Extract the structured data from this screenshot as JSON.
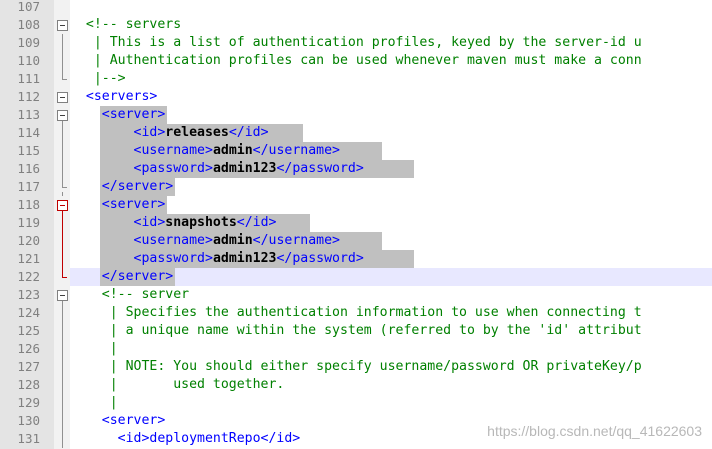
{
  "editor": {
    "lines": [
      {
        "no": "107",
        "segs": []
      },
      {
        "no": "108",
        "segs": [
          {
            "t": "  <!-- servers",
            "c": "cmt"
          }
        ]
      },
      {
        "no": "109",
        "segs": [
          {
            "t": "   | This is a list of authentication profiles, keyed by the server-id u",
            "c": "cmt"
          }
        ]
      },
      {
        "no": "110",
        "segs": [
          {
            "t": "   | Authentication profiles can be used whenever maven must make a conn",
            "c": "cmt"
          }
        ]
      },
      {
        "no": "111",
        "segs": [
          {
            "t": "   |-->",
            "c": "cmt"
          }
        ]
      },
      {
        "no": "112",
        "segs": [
          {
            "t": "  <servers>",
            "c": "tag"
          }
        ]
      },
      {
        "no": "113",
        "segs": [
          {
            "t": "    ",
            "c": "pl"
          },
          {
            "t": "<server>",
            "c": "tag"
          }
        ]
      },
      {
        "no": "114",
        "segs": [
          {
            "t": "        ",
            "c": "pl"
          },
          {
            "t": "<id>",
            "c": "tag"
          },
          {
            "t": "releases",
            "c": "txt"
          },
          {
            "t": "</id>",
            "c": "tag"
          }
        ]
      },
      {
        "no": "115",
        "segs": [
          {
            "t": "        ",
            "c": "pl"
          },
          {
            "t": "<username>",
            "c": "tag"
          },
          {
            "t": "admin",
            "c": "txt"
          },
          {
            "t": "</username>",
            "c": "tag"
          }
        ]
      },
      {
        "no": "116",
        "segs": [
          {
            "t": "        ",
            "c": "pl"
          },
          {
            "t": "<password>",
            "c": "tag"
          },
          {
            "t": "admin123",
            "c": "txt"
          },
          {
            "t": "</password>",
            "c": "tag"
          }
        ]
      },
      {
        "no": "117",
        "segs": [
          {
            "t": "    ",
            "c": "pl"
          },
          {
            "t": "</server>",
            "c": "tag"
          }
        ]
      },
      {
        "no": "118",
        "segs": [
          {
            "t": "    ",
            "c": "pl"
          },
          {
            "t": "<server>",
            "c": "tag"
          }
        ]
      },
      {
        "no": "119",
        "segs": [
          {
            "t": "        ",
            "c": "pl"
          },
          {
            "t": "<id>",
            "c": "tag"
          },
          {
            "t": "snapshots",
            "c": "txt"
          },
          {
            "t": "</id>",
            "c": "tag"
          }
        ]
      },
      {
        "no": "120",
        "segs": [
          {
            "t": "        ",
            "c": "pl"
          },
          {
            "t": "<username>",
            "c": "tag"
          },
          {
            "t": "admin",
            "c": "txt"
          },
          {
            "t": "</username>",
            "c": "tag"
          }
        ]
      },
      {
        "no": "121",
        "segs": [
          {
            "t": "        ",
            "c": "pl"
          },
          {
            "t": "<password>",
            "c": "tag"
          },
          {
            "t": "admin123",
            "c": "txt"
          },
          {
            "t": "</password>",
            "c": "tag"
          }
        ]
      },
      {
        "no": "122",
        "segs": [
          {
            "t": "    ",
            "c": "pl"
          },
          {
            "t": "</server>",
            "c": "tag"
          }
        ]
      },
      {
        "no": "123",
        "segs": [
          {
            "t": "    <!-- server",
            "c": "cmt"
          }
        ]
      },
      {
        "no": "124",
        "segs": [
          {
            "t": "     | Specifies the authentication information to use when connecting t",
            "c": "cmt"
          }
        ]
      },
      {
        "no": "125",
        "segs": [
          {
            "t": "     | a unique name within the system (referred to by the 'id' attribut",
            "c": "cmt"
          }
        ]
      },
      {
        "no": "126",
        "segs": [
          {
            "t": "     |",
            "c": "cmt"
          }
        ]
      },
      {
        "no": "127",
        "segs": [
          {
            "t": "     | NOTE: You should either specify username/password OR privateKey/p",
            "c": "cmt"
          }
        ]
      },
      {
        "no": "128",
        "segs": [
          {
            "t": "     |       used together.",
            "c": "cmt"
          }
        ]
      },
      {
        "no": "129",
        "segs": [
          {
            "t": "     |",
            "c": "cmt"
          }
        ]
      },
      {
        "no": "130",
        "segs": [
          {
            "t": "    <server>",
            "c": "tag"
          }
        ]
      },
      {
        "no": "131",
        "segs": [
          {
            "t": "      <id>deploymentRepo</id>",
            "c": "tag"
          }
        ]
      }
    ]
  },
  "watermark": "https://blog.csdn.net/qq_41622603"
}
